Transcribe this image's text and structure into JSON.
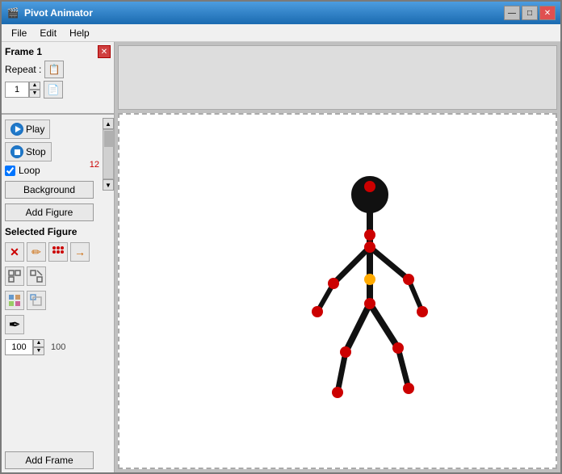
{
  "window": {
    "title": "Pivot Animator",
    "icon": "🎬"
  },
  "title_controls": {
    "minimize": "—",
    "maximize": "□",
    "close": "✕"
  },
  "menu": {
    "items": [
      "File",
      "Edit",
      "Help"
    ]
  },
  "frame_panel": {
    "title": "Frame 1",
    "repeat_label": "Repeat :",
    "repeat_value": "1",
    "copy_icon": "📋"
  },
  "controls": {
    "play_label": "Play",
    "stop_label": "Stop",
    "loop_label": "Loop",
    "loop_checked": true,
    "frame_count": "12",
    "background_label": "Background",
    "add_figure_label": "Add Figure",
    "selected_figure_label": "Selected Figure",
    "add_frame_label": "Add Frame"
  },
  "figure_tools": {
    "delete_icon": "✕",
    "edit_icon": "✏",
    "dots1_icon": "⠿",
    "arrow_icon": "→",
    "copy1_icon": "⧉",
    "copy2_icon": "⧉",
    "grid1_icon": "⊞",
    "grid2_icon": "⊟",
    "pencil_icon": "✏",
    "size_value": "100",
    "size_display": "100"
  },
  "canvas": {
    "bg_color": "#ffffff",
    "border_style": "dashed"
  },
  "stick_figure": {
    "joint_color": "#cc0000",
    "center_color": "#ffaa00",
    "body_color": "#111111"
  }
}
